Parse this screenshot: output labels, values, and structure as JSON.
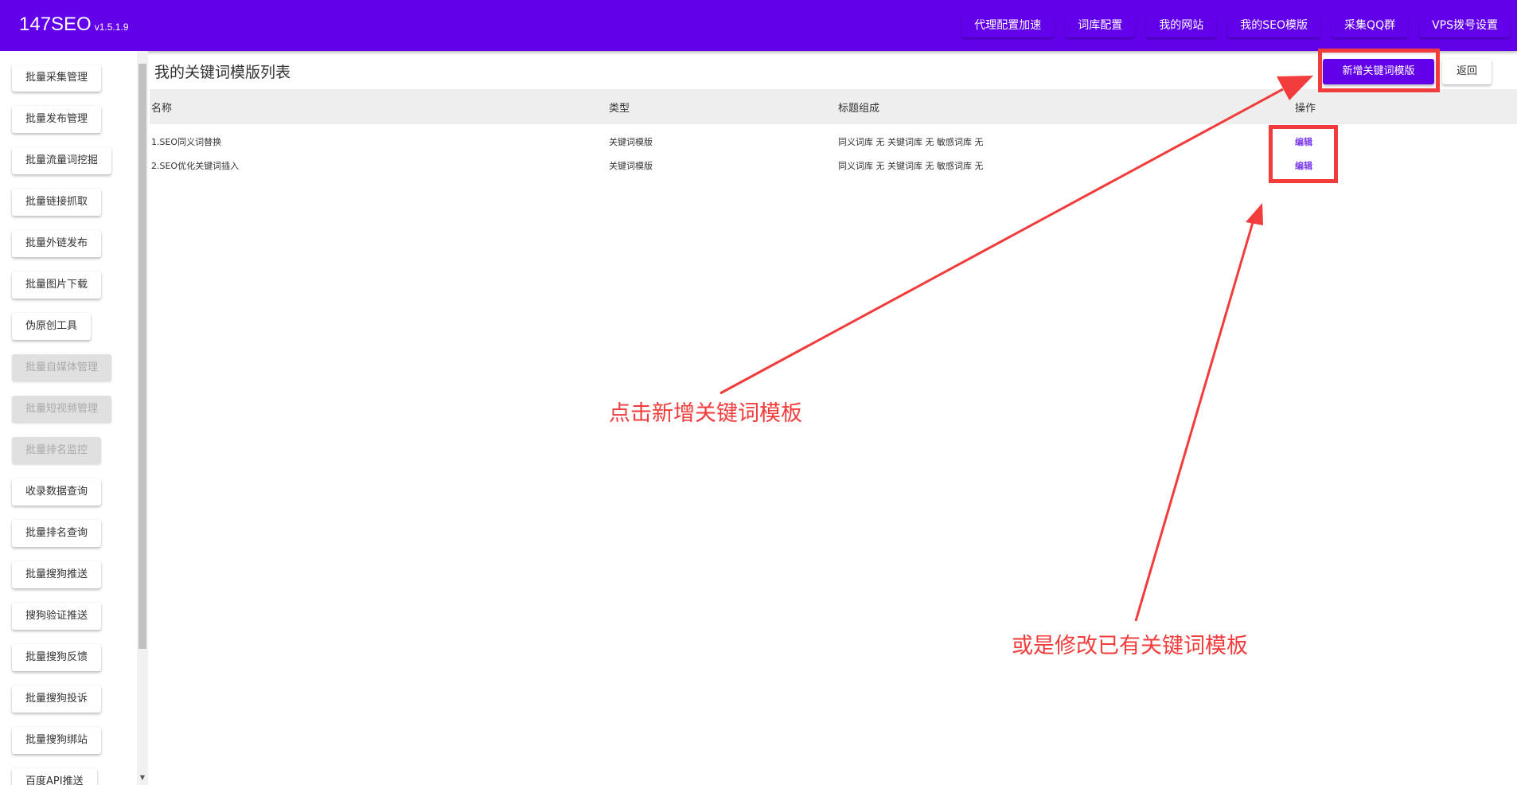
{
  "app": {
    "name": "147SEO",
    "version": "v1.5.1.9"
  },
  "topnav": [
    "代理配置加速",
    "词库配置",
    "我的网站",
    "我的SEO模版",
    "采集QQ群",
    "VPS拨号设置"
  ],
  "sidebar": [
    {
      "label": "批量采集管理",
      "disabled": false
    },
    {
      "label": "批量发布管理",
      "disabled": false
    },
    {
      "label": "批量流量词挖掘",
      "disabled": false
    },
    {
      "label": "批量链接抓取",
      "disabled": false
    },
    {
      "label": "批量外链发布",
      "disabled": false
    },
    {
      "label": "批量图片下载",
      "disabled": false
    },
    {
      "label": "伪原创工具",
      "disabled": false
    },
    {
      "label": "批量自媒体管理",
      "disabled": true
    },
    {
      "label": "批量短视频管理",
      "disabled": true
    },
    {
      "label": "批量排名监控",
      "disabled": true
    },
    {
      "label": "收录数据查询",
      "disabled": false
    },
    {
      "label": "批量排名查询",
      "disabled": false
    },
    {
      "label": "批量搜狗推送",
      "disabled": false
    },
    {
      "label": "搜狗验证推送",
      "disabled": false
    },
    {
      "label": "批量搜狗反馈",
      "disabled": false
    },
    {
      "label": "批量搜狗投诉",
      "disabled": false
    },
    {
      "label": "批量搜狗绑站",
      "disabled": false
    },
    {
      "label": "百度API推送",
      "disabled": false
    }
  ],
  "main": {
    "title": "我的关键词模版列表",
    "add_label": "新增关键词模版",
    "back_label": "返回",
    "columns": [
      "名称",
      "类型",
      "标题组成",
      "操作"
    ],
    "rows": [
      {
        "name": "1.SEO同义词替换",
        "type": "关键词模版",
        "composition": "同义词库 无 关键词库 无 敏感词库 无",
        "action": "编辑"
      },
      {
        "name": "2.SEO优化关键词插入",
        "type": "关键词模版",
        "composition": "同义词库 无 关键词库 无 敏感词库 无",
        "action": "编辑"
      }
    ]
  },
  "annotations": {
    "text1": "点击新增关键词模板",
    "text2": "或是修改已有关键词模板",
    "color": "#f23b3b"
  },
  "colors": {
    "brand": "#6200ea",
    "edit_link": "#7c3aed"
  }
}
